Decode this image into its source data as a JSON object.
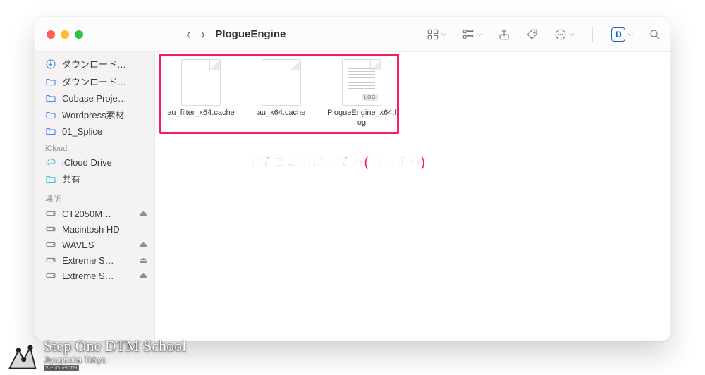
{
  "window": {
    "title": "PlogueEngine"
  },
  "sidebar": {
    "folders": [
      {
        "label": "ダウンロード…"
      },
      {
        "label": "ダウンロード…"
      },
      {
        "label": "Cubase Proje…"
      },
      {
        "label": "Wordpress素材"
      },
      {
        "label": "01_Splice"
      }
    ],
    "icloud_section": "iCloud",
    "icloud": [
      {
        "label": "iCloud Drive"
      },
      {
        "label": "共有"
      }
    ],
    "locations_section": "場所",
    "locations": [
      {
        "label": "CT2050M…",
        "eject": true
      },
      {
        "label": "Macintosh HD",
        "eject": false
      },
      {
        "label": "WAVES",
        "eject": true
      },
      {
        "label": "Extreme S…",
        "eject": true
      },
      {
        "label": "Extreme S…",
        "eject": true
      }
    ]
  },
  "files": [
    {
      "name": "au_filter_x64.cache",
      "type": "cache"
    },
    {
      "name": "au_x64.cache",
      "type": "cache"
    },
    {
      "name": "PlogueEngine_x64.log",
      "type": "log"
    }
  ],
  "annotation": "全てゴミ箱に捨てる(削除する)",
  "watermark": {
    "title": "Step One DTM School",
    "subtitle": "Jiyugaoka Tokyo",
    "tag": "StepOneDTM"
  },
  "toolbar": {
    "d_label": "D"
  }
}
